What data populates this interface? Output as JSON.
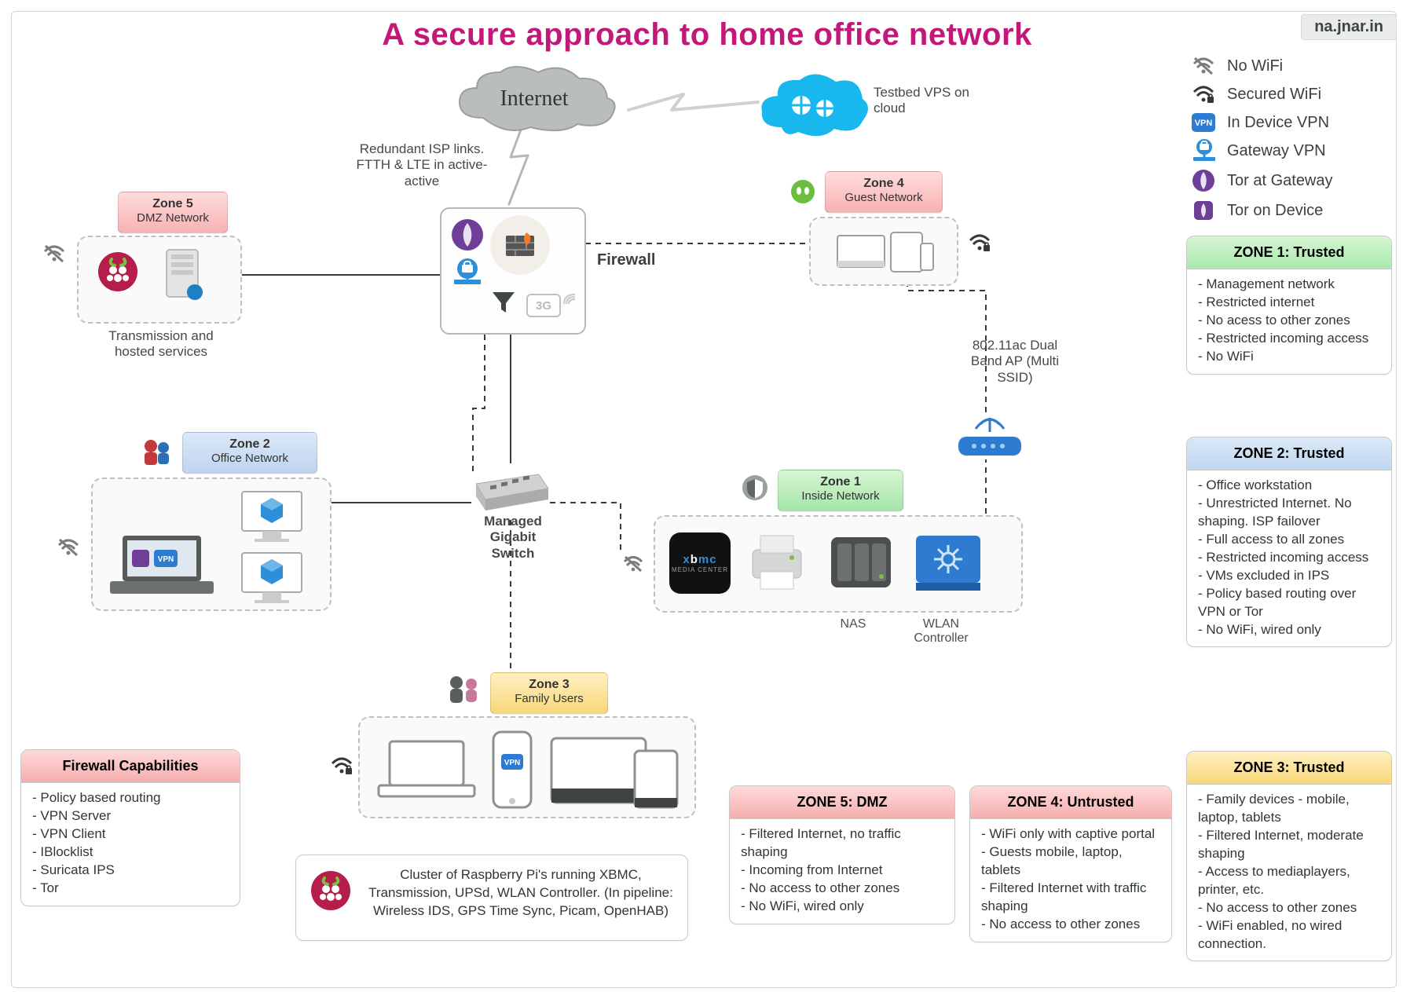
{
  "title": "A secure approach to home office network",
  "attribution": "na.jnar.in",
  "legend": [
    {
      "icon": "wifi-off",
      "label": "No WiFi"
    },
    {
      "icon": "wifi-lock",
      "label": "Secured WiFi"
    },
    {
      "icon": "vpn-badge",
      "label": "In Device VPN"
    },
    {
      "icon": "gateway-vpn",
      "label": "Gateway VPN"
    },
    {
      "icon": "tor-gateway",
      "label": "Tor at Gateway"
    },
    {
      "icon": "tor-device",
      "label": "Tor on Device"
    }
  ],
  "annotations": {
    "internet": "Internet",
    "vps": "Testbed VPS on cloud",
    "isp": "Redundant ISP links. FTTH & LTE in active-active",
    "firewall": "Firewall",
    "switch": "Managed Gigabit Switch",
    "ap": "802.11ac Dual Band AP (Multi SSID)",
    "nas": "NAS",
    "wlanc": "WLAN Controller",
    "dmz_sub": "Transmission and hosted services",
    "badge3g": "3G",
    "pi_cluster": "Cluster of Raspberry Pi's running XBMC, Transmission, UPSd, WLAN Controller. (In pipeline: Wireless IDS, GPS Time Sync, Picam, OpenHAB)"
  },
  "zones": {
    "z1": {
      "title": "Zone 1",
      "sub": "Inside Network"
    },
    "z2": {
      "title": "Zone 2",
      "sub": "Office Network"
    },
    "z3": {
      "title": "Zone 3",
      "sub": "Family Users"
    },
    "z4": {
      "title": "Zone 4",
      "sub": "Guest Network"
    },
    "z5": {
      "title": "Zone 5",
      "sub": "DMZ Network"
    }
  },
  "cards": {
    "fw": {
      "title": "Firewall Capabilities",
      "items": [
        "Policy based routing",
        "VPN Server",
        "VPN Client",
        "IBlocklist",
        "Suricata IPS",
        "Tor"
      ]
    },
    "z1": {
      "title": "ZONE 1: Trusted",
      "items": [
        "Management network",
        "Restricted internet",
        "No acess to other zones",
        "Restricted incoming access",
        "No WiFi"
      ]
    },
    "z2": {
      "title": "ZONE 2: Trusted",
      "items": [
        "Office workstation",
        "Unrestricted Internet. No shaping. ISP failover",
        "Full access to all zones",
        "Restricted incoming access",
        "VMs excluded in IPS",
        "Policy based routing over VPN or Tor",
        "No WiFi, wired only"
      ]
    },
    "z3": {
      "title": "ZONE 3: Trusted",
      "items": [
        "Family devices - mobile, laptop, tablets",
        "Filtered Internet, moderate shaping",
        "Access to mediaplayers, printer, etc.",
        "No access to other zones",
        "WiFi enabled, no wired connection."
      ]
    },
    "z4": {
      "title": "ZONE 4: Untrusted",
      "items": [
        "WiFi only with captive portal",
        "Guests mobile, laptop, tablets",
        "Filtered Internet with traffic shaping",
        "No access to other zones"
      ]
    },
    "z5": {
      "title": "ZONE 5: DMZ",
      "items": [
        "Filtered Internet, no traffic shaping",
        "Incoming from Internet",
        "No access to other zones",
        "No WiFi, wired only"
      ]
    }
  }
}
